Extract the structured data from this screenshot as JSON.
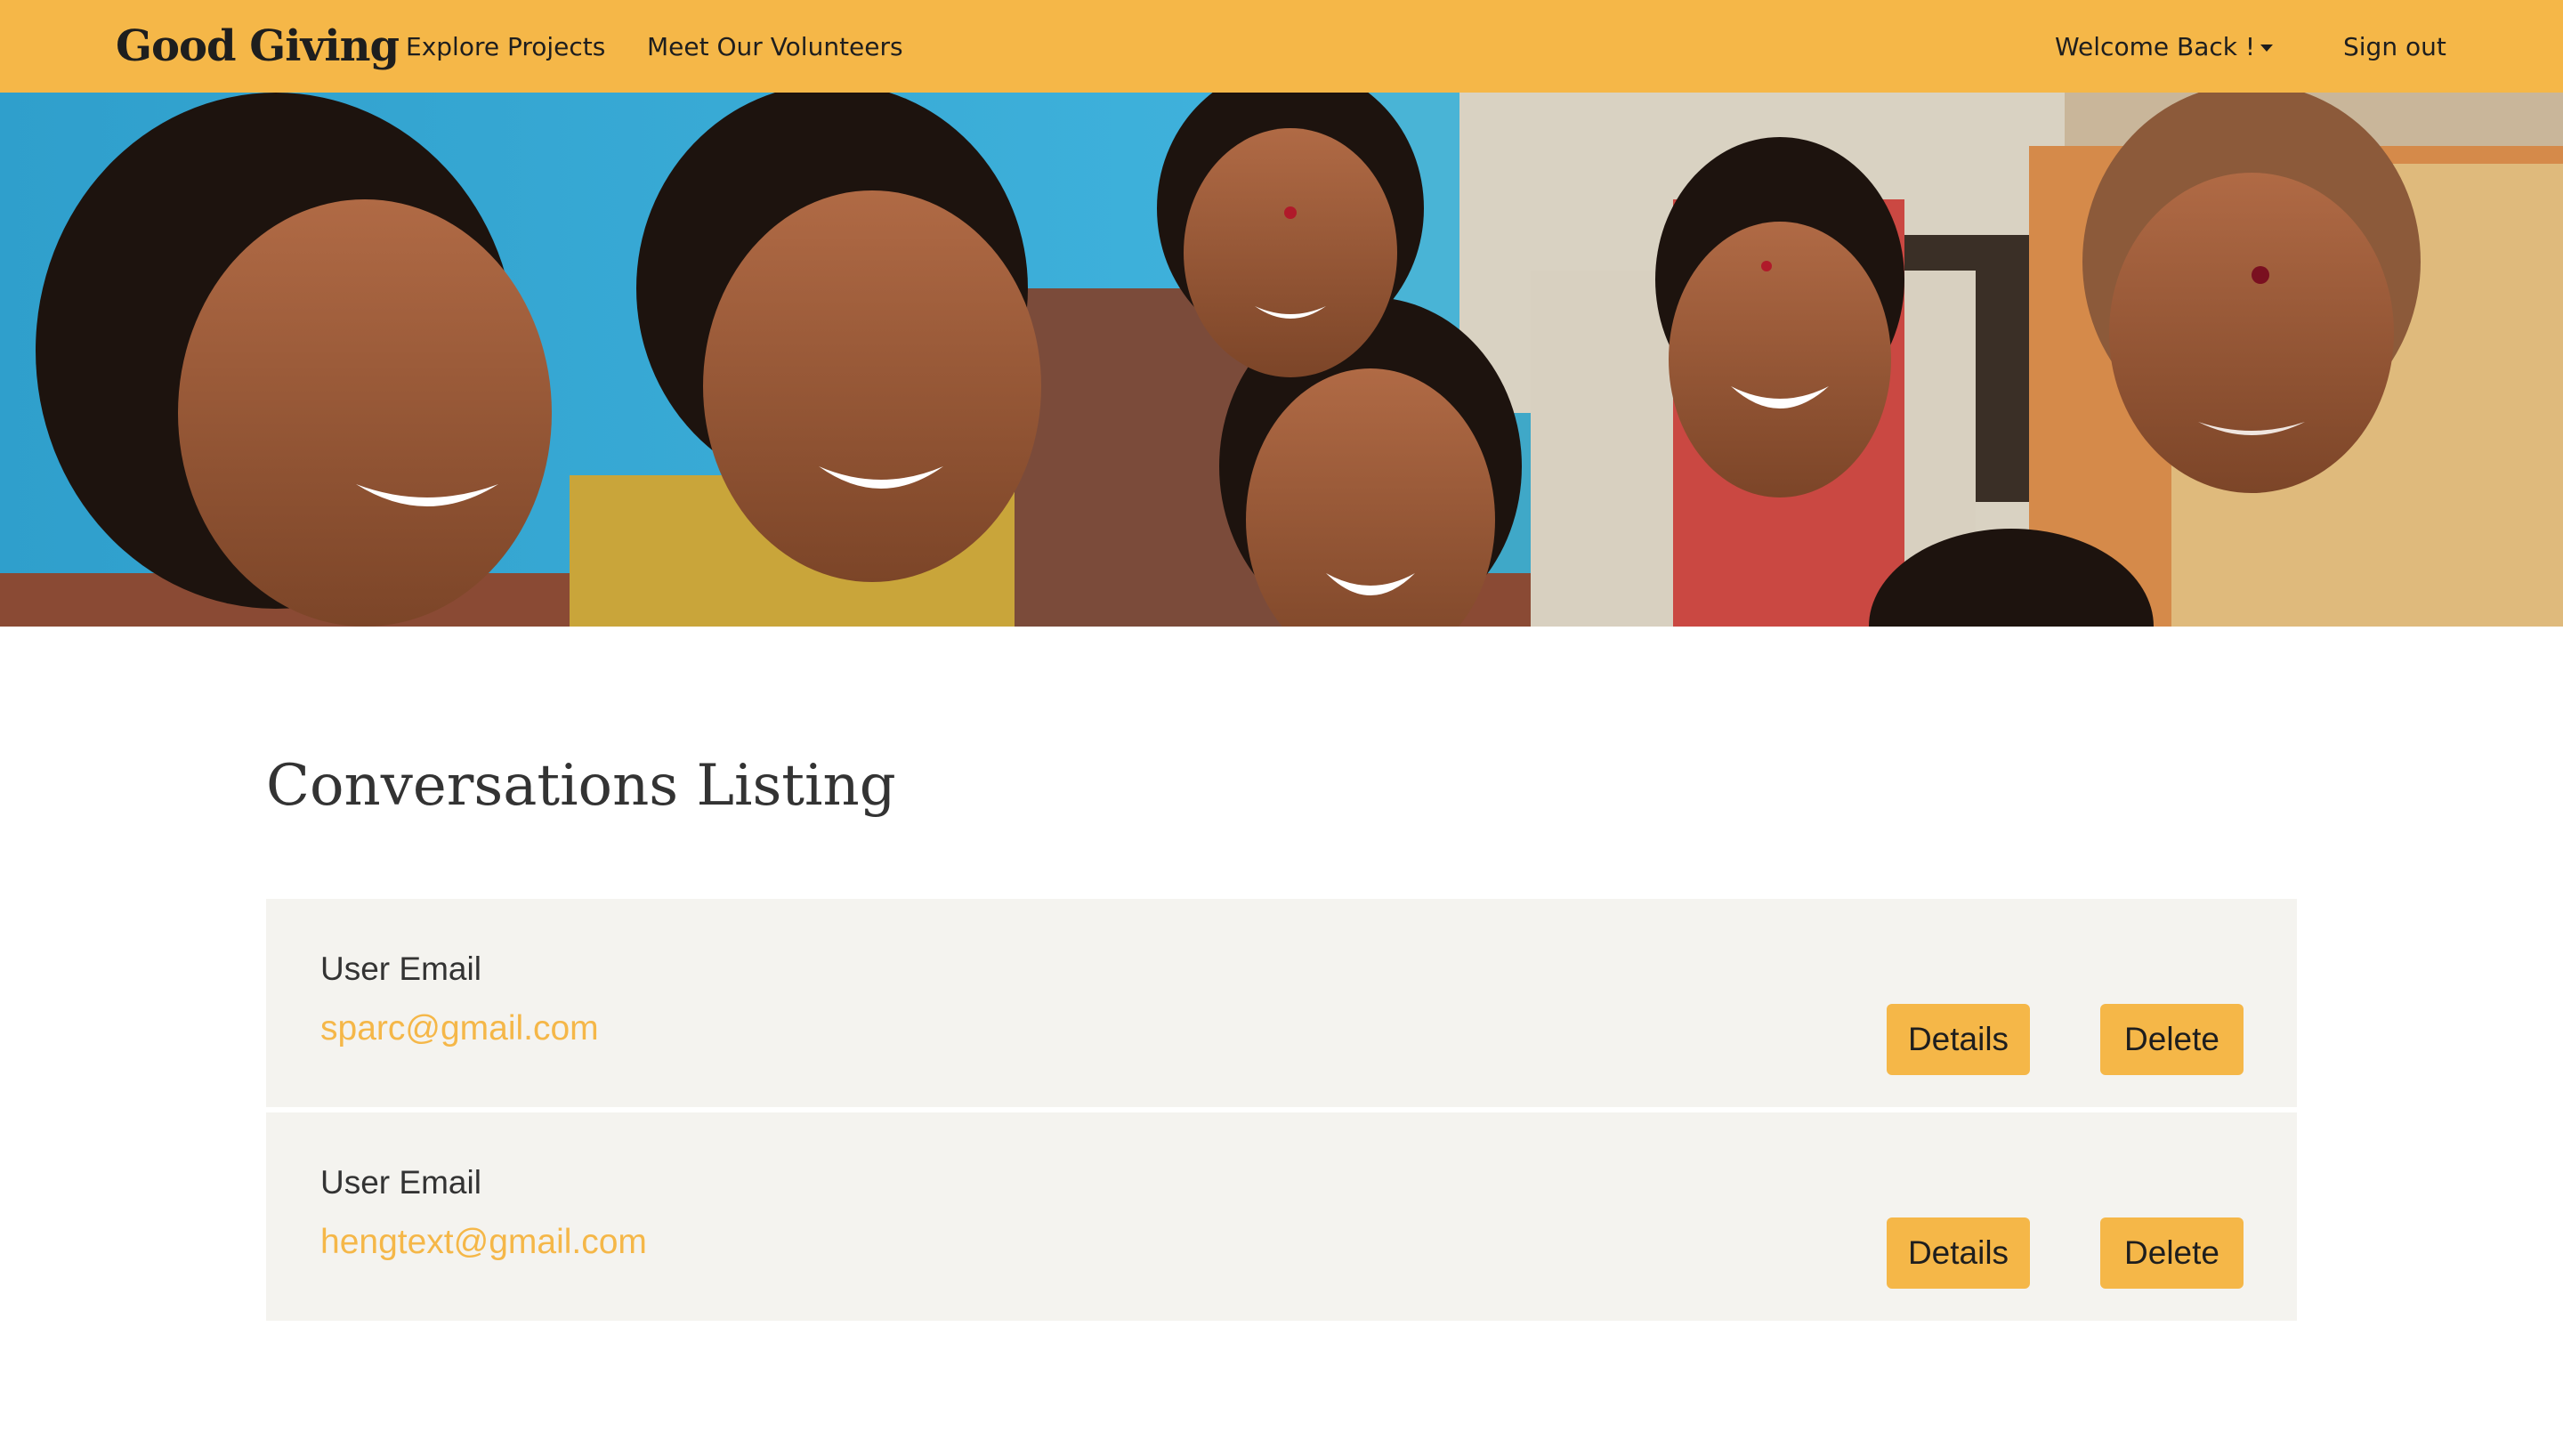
{
  "navbar": {
    "brand": "Good Giving",
    "links": [
      "Explore Projects",
      "Meet Our Volunteers"
    ],
    "welcome": "Welcome Back !",
    "sign_out": "Sign out"
  },
  "main": {
    "title": "Conversations Listing",
    "conversations": [
      {
        "label": "User Email",
        "email": "sparc@gmail.com",
        "details": "Details",
        "delete": "Delete"
      },
      {
        "label": "User Email",
        "email": "hengtext@gmail.com",
        "details": "Details",
        "delete": "Delete"
      }
    ]
  },
  "colors": {
    "accent": "#f5b748",
    "row_bg": "#f4f3ef",
    "text": "#333333"
  }
}
